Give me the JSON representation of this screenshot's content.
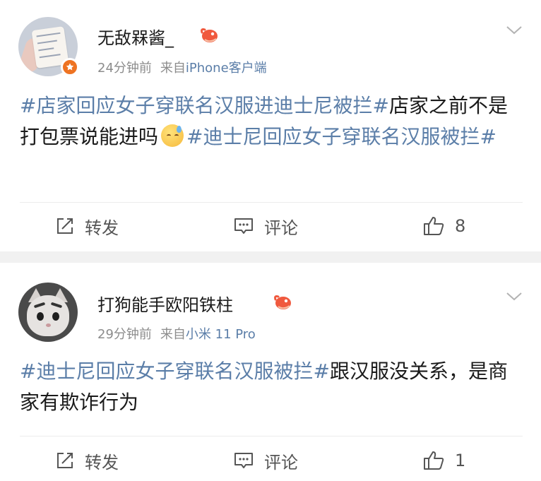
{
  "posts": [
    {
      "author": "无敌槑酱_",
      "time": "24分钟前",
      "source_prefix": "来自",
      "source": "iPhone客户端",
      "verified": true,
      "content": {
        "tag1": "#店家回应女子穿联名汉服进迪士尼被拦#",
        "text1": "店家之前不是打包票说能进吗",
        "emoji": "cold-sweat-emoji",
        "tag2": "#迪士尼回应女子穿联名汉服被拦#"
      },
      "actions": {
        "repost": "转发",
        "comment": "评论",
        "likes": "8"
      }
    },
    {
      "author": "打狗能手欧阳铁柱",
      "time": "29分钟前",
      "source_prefix": "来自",
      "source": "小米 11 Pro",
      "verified": false,
      "content": {
        "tag1": "#迪士尼回应女子穿联名汉服被拦#",
        "text1": "跟汉服没关系，是商家有欺诈行为"
      },
      "actions": {
        "repost": "转发",
        "comment": "评论",
        "likes": "1"
      }
    }
  ],
  "colors": {
    "link": "#5b7ea8",
    "meta": "#8c8c8c",
    "separator": "#f1f1f1",
    "verify_badge": "#ee7322"
  },
  "icons": [
    "chevron-down-icon",
    "repost-icon",
    "comment-icon",
    "like-icon",
    "fan-badge-icon",
    "verified-icon"
  ]
}
